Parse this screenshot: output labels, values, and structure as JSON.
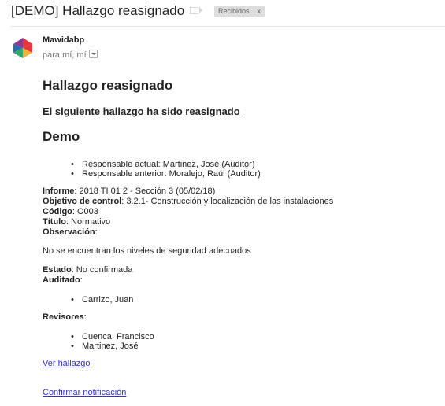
{
  "email": {
    "subject": "[DEMO] Hallazgo reasignado",
    "label_chip": "Recibidos",
    "label_chip_close": "x",
    "sender_name": "Mawidabp",
    "recipients": "para mí, mí"
  },
  "body": {
    "title": "Hallazgo reasignado",
    "subtitle": "El siguiente hallazgo ha sido reasignado",
    "section": "Demo",
    "responsables": [
      "Responsable actual: Martinez, José (Auditor)",
      "Responsable anterior: Moralejo, Raúl (Auditor)"
    ],
    "informe_label": "Informe",
    "informe_value": ": 2018 TI 01 2 - Sección 3 (05/02/18)",
    "objetivo_label": "Objetivo de control",
    "objetivo_value": ": 3.2.1- Construcción y localización de las instalaciones",
    "codigo_label": "Código",
    "codigo_value": ": O003",
    "titulo_label": "Título",
    "titulo_value": ": Normativo",
    "observacion_label": "Observación",
    "observacion_value": ":",
    "observacion_text": "No se encuentran los niveles de seguridad adecuados",
    "estado_label": "Estado",
    "estado_value": ": No confirmada",
    "auditado_label": "Auditado",
    "auditado_value": ":",
    "auditados": [
      "Carrizo, Juan"
    ],
    "revisores_label": "Revisores",
    "revisores_value": ":",
    "revisores": [
      "Cuenca, Francisco",
      "Martinez, José"
    ],
    "link_ver": "Ver hallazgo",
    "link_confirmar": "Confirmar notificación"
  },
  "colors": {
    "link": "#3333cc",
    "logo_red": "#e8343a",
    "logo_blue": "#2b6cb0",
    "logo_green": "#2faa6a",
    "logo_yellow": "#f2b632",
    "logo_purple": "#8e3b8f"
  }
}
